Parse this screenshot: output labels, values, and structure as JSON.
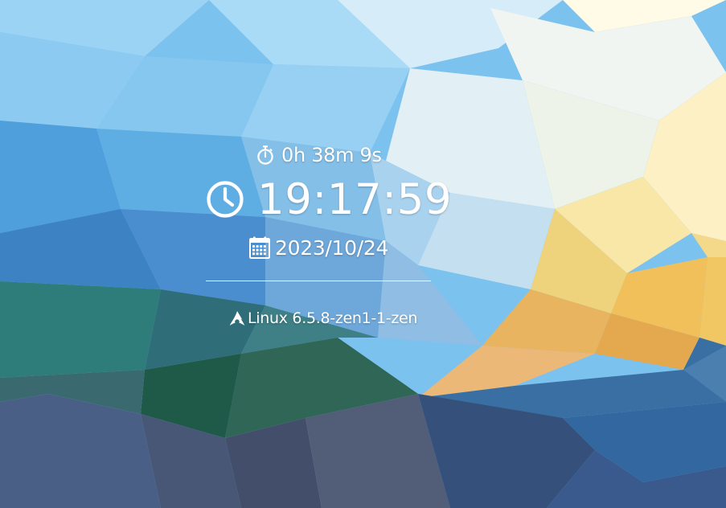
{
  "widget": {
    "uptime": "0h 38m 9s",
    "time": "19:17:59",
    "date": "2023/10/24",
    "kernel": "Linux 6.5.8-zen1-1-zen"
  },
  "icons": {
    "uptime": "stopwatch-icon",
    "time": "clock-icon",
    "date": "calendar-icon",
    "kernel": "arch-linux-logo-icon"
  },
  "colors": {
    "text": "#ffffff"
  }
}
